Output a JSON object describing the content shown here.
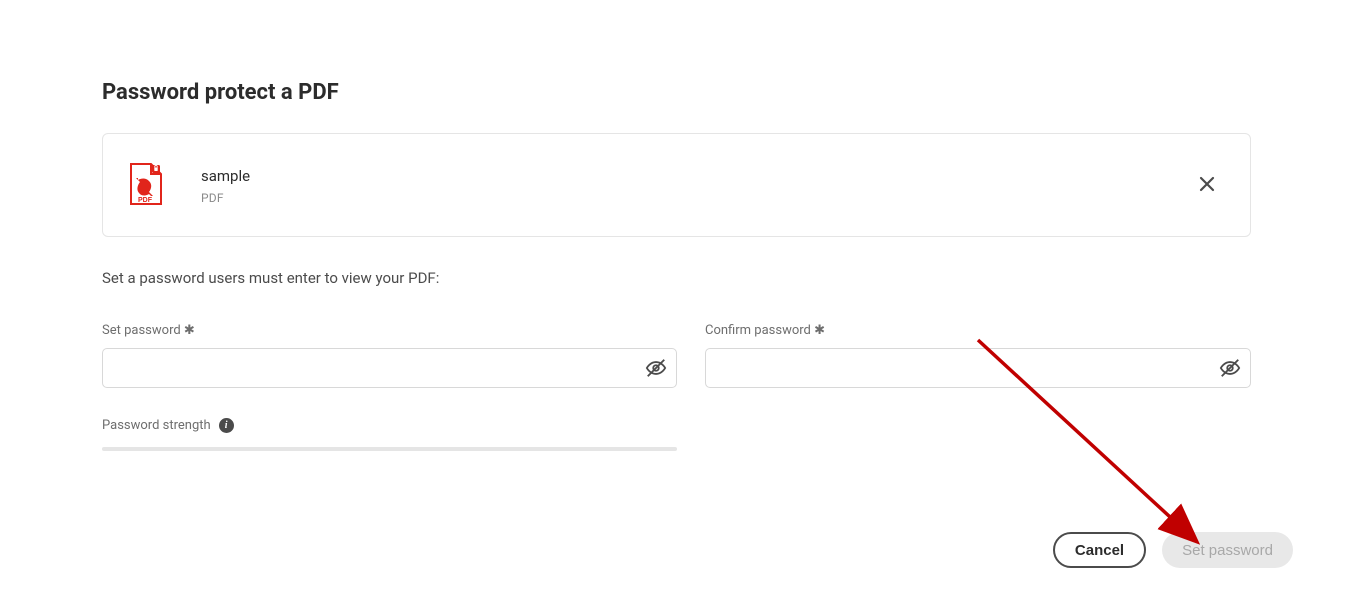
{
  "page": {
    "title": "Password protect a PDF",
    "instruction": "Set a password users must enter to view your PDF:"
  },
  "file": {
    "name": "sample",
    "type": "PDF"
  },
  "fields": {
    "set_password_label": "Set password",
    "confirm_password_label": "Confirm password",
    "required_marker": "✱"
  },
  "strength": {
    "label": "Password strength"
  },
  "buttons": {
    "cancel": "Cancel",
    "submit": "Set password"
  }
}
